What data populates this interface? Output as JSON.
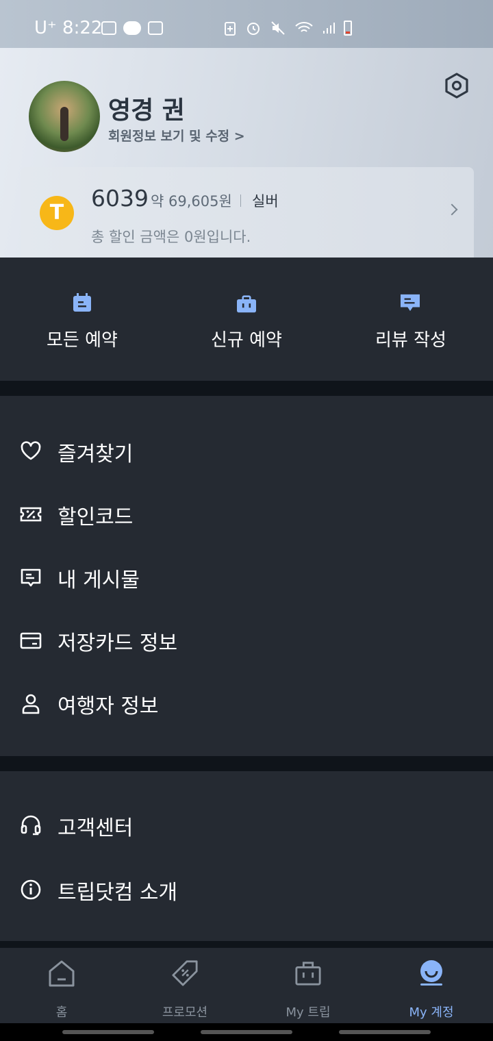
{
  "status_bar": {
    "time": "8:22",
    "carrier": "U⁺"
  },
  "profile": {
    "name": "영경 권",
    "edit_link": "회원정보 보기 및 수정 >"
  },
  "points": {
    "coin_letter": "T",
    "value": "6039",
    "approx": "약 69,605원",
    "tier": "실버",
    "subtitle": "총 할인 금액은 0원입니다."
  },
  "quick_actions": [
    {
      "label": "모든 예약",
      "icon": "calendar-icon"
    },
    {
      "label": "신규 예약",
      "icon": "suitcase-icon"
    },
    {
      "label": "리뷰 작성",
      "icon": "comment-icon"
    }
  ],
  "menu_section_1": [
    {
      "label": "즐겨찾기",
      "icon": "heart-icon"
    },
    {
      "label": "할인코드",
      "icon": "coupon-icon"
    },
    {
      "label": "내 게시물",
      "icon": "message-icon"
    },
    {
      "label": "저장카드 정보",
      "icon": "card-icon"
    },
    {
      "label": "여행자 정보",
      "icon": "person-icon"
    }
  ],
  "menu_section_2": [
    {
      "label": "고객센터",
      "icon": "headset-icon"
    },
    {
      "label": "트립닷컴 소개",
      "icon": "info-icon"
    }
  ],
  "bottom_nav": [
    {
      "label": "홈",
      "icon": "home-icon"
    },
    {
      "label": "프로모션",
      "icon": "tag-icon"
    },
    {
      "label": "My 트립",
      "icon": "briefcase-icon"
    },
    {
      "label": "My 계정",
      "icon": "account-icon",
      "active": true
    }
  ],
  "colors": {
    "accent": "#8ab4f8",
    "panel": "#252a32",
    "coin": "#f7b718"
  }
}
